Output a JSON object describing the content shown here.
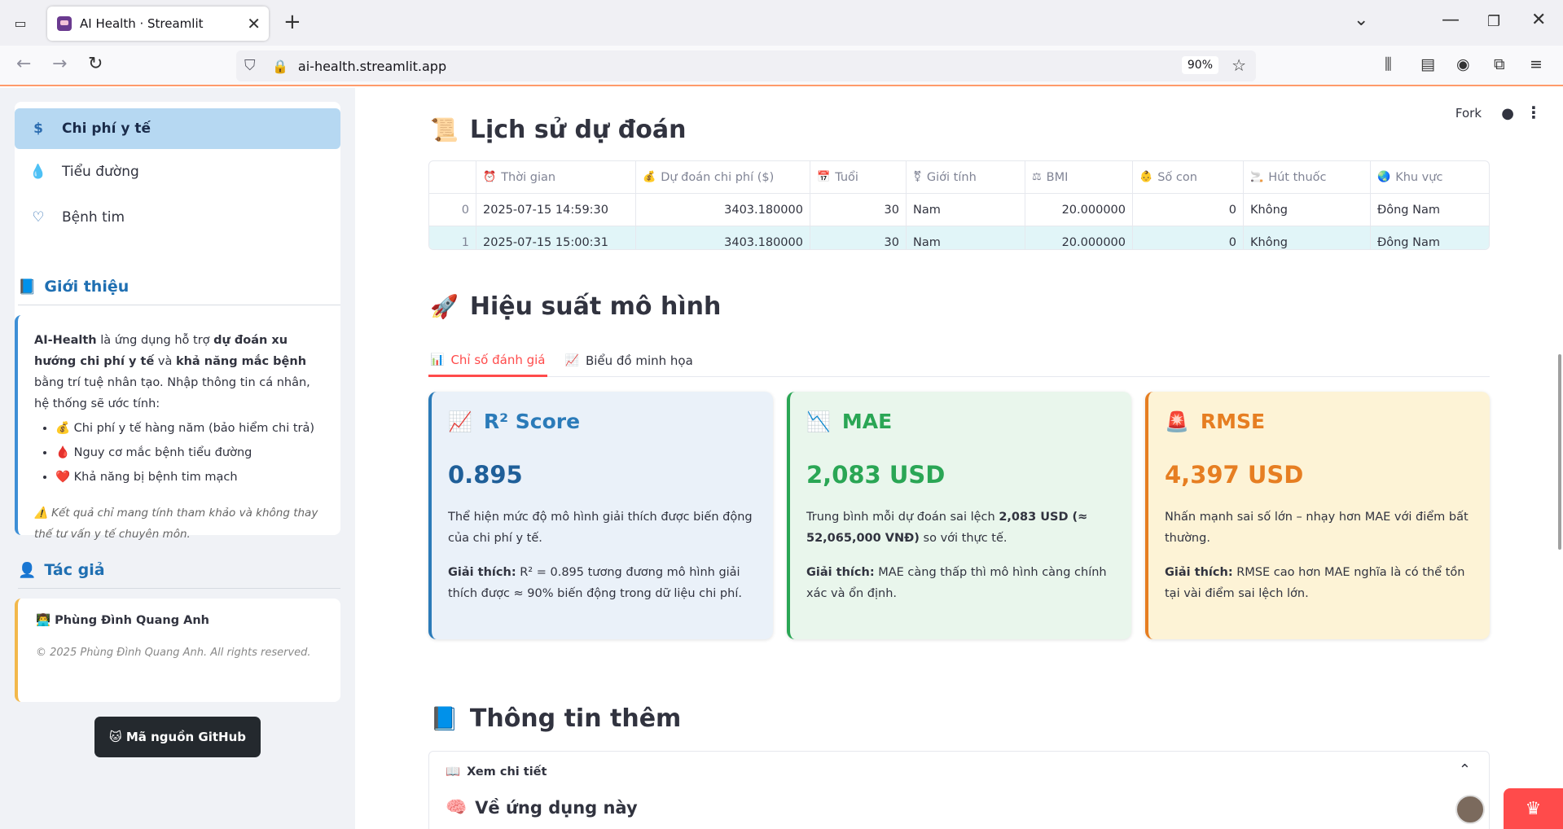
{
  "browser": {
    "tab_title": "AI Health · Streamlit",
    "url": "ai-health.streamlit.app",
    "zoom": "90%"
  },
  "sidebar": {
    "menu": [
      {
        "label": "Chi phí y tế",
        "icon": "dollar-icon",
        "active": true
      },
      {
        "label": "Tiểu đường",
        "icon": "droplet-icon",
        "active": false
      },
      {
        "label": "Bệnh tim",
        "icon": "heartbeat-icon",
        "active": false
      }
    ],
    "intro_heading": "Giới thiệu",
    "intro": {
      "p1_a": "AI-Health",
      "p1_b": " là ứng dụng hỗ trợ ",
      "p1_c": "dự đoán xu hướng chi phí y tế",
      "p1_d": " và ",
      "p1_e": "khả năng mắc bệnh",
      "p1_f": " bằng trí tuệ nhân tạo. Nhập thông tin cá nhân, hệ thống sẽ ước tính:",
      "items": [
        "💰 Chi phí y tế hàng năm (bảo hiểm chi trả)",
        "🩸 Nguy cơ mắc bệnh tiểu đường",
        "❤️ Khả năng bị bệnh tim mạch"
      ],
      "note": "⚠️ Kết quả chỉ mang tính tham khảo và không thay thế tư vấn y tế chuyên môn."
    },
    "author_heading": "Tác giả",
    "author": {
      "name": "👨‍💻 Phùng Đình Quang Anh",
      "copyright": "© 2025 Phùng Đình Quang Anh. All rights reserved."
    },
    "github_button": "🐱 Mã nguồn GitHub"
  },
  "header": {
    "fork": "Fork"
  },
  "history": {
    "title": "Lịch sử dự đoán",
    "columns": [
      "Thời gian",
      "Dự đoán chi phí ($)",
      "Tuổi",
      "Giới tính",
      "BMI",
      "Số con",
      "Hút thuốc",
      "Khu vực"
    ],
    "rows": [
      {
        "idx": "0",
        "time": "2025-07-15 14:59:30",
        "cost": "3403.180000",
        "age": "30",
        "sex": "Nam",
        "bmi": "20.000000",
        "children": "0",
        "smoker": "Không",
        "region": "Đông Nam"
      },
      {
        "idx": "1",
        "time": "2025-07-15 15:00:31",
        "cost": "3403.180000",
        "age": "30",
        "sex": "Nam",
        "bmi": "20.000000",
        "children": "0",
        "smoker": "Không",
        "region": "Đông Nam"
      }
    ]
  },
  "performance": {
    "title": "Hiệu suất mô hình",
    "tabs": [
      "Chỉ số đánh giá",
      "Biểu đồ minh họa"
    ],
    "cards": [
      {
        "title": "R² Score",
        "value": "0.895",
        "desc": "Thể hiện mức độ mô hình giải thích được biến động của chi phí y tế.",
        "explain_label": "Giải thích:",
        "explain": " R² = 0.895 tương đương mô hình giải thích được ≈ 90% biến động trong dữ liệu chi phí.",
        "color": "#2b7bb9"
      },
      {
        "title": "MAE",
        "value": "2,083 USD",
        "desc_a": "Trung bình mỗi dự đoán sai lệch ",
        "desc_b": "2,083 USD (≈ 52,065,000 VNĐ)",
        "desc_c": " so với thực tế.",
        "explain_label": "Giải thích:",
        "explain": " MAE càng thấp thì mô hình càng chính xác và ổn định.",
        "color": "#2aa655"
      },
      {
        "title": "RMSE",
        "value": "4,397 USD",
        "desc": "Nhấn mạnh sai số lớn – nhạy hơn MAE với điểm bất thường.",
        "explain_label": "Giải thích:",
        "explain": " RMSE cao hơn MAE nghĩa là có thể tồn tại vài điểm sai lệch lớn.",
        "color": "#e67e22"
      }
    ]
  },
  "more_info": {
    "title": "Thông tin thêm",
    "expander_label": "Xem chi tiết",
    "about_title": "Về ứng dụng này"
  }
}
